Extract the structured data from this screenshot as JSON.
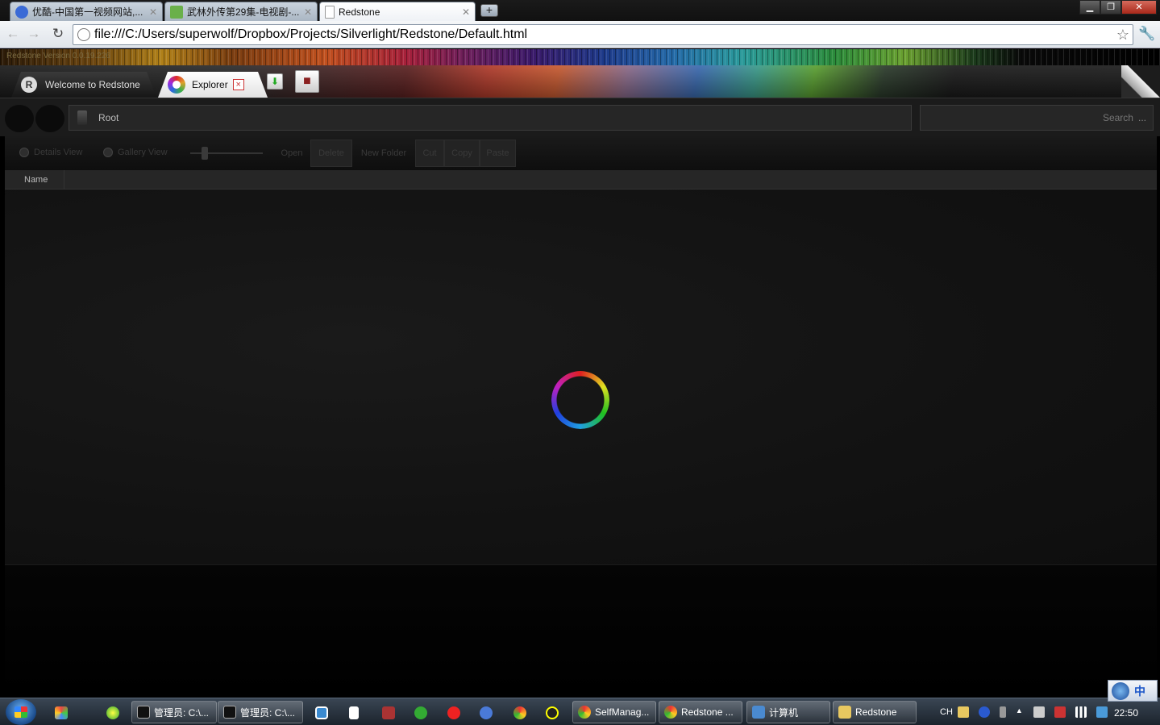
{
  "browser": {
    "tabs": [
      {
        "title": "优酷-中国第一视频网站,...",
        "favicon_color": "#3a6ad6",
        "active": false
      },
      {
        "title": "武林外传第29集-电视剧-...",
        "favicon_color": "#6ab04a",
        "active": false
      },
      {
        "title": "Redstone",
        "favicon_color": "#ffffff",
        "active": true
      }
    ],
    "new_tab_label": "+",
    "url": "file:///C:/Users/superwolf/Dropbox/Projects/Silverlight/Redstone/Default.html"
  },
  "app": {
    "version": "Redstone Version 0.0.19.226",
    "tabs": [
      {
        "label": "Welcome to Redstone",
        "icon_letter": "R"
      },
      {
        "label": "Explorer",
        "close": "×"
      }
    ],
    "breadcrumb": {
      "root": "Root"
    },
    "search": {
      "placeholder": "Search",
      "more": "..."
    },
    "view_options": {
      "details": "Details View",
      "gallery": "Gallery View"
    },
    "commands": {
      "open": "Open",
      "delete": "Delete",
      "new_folder": "New Folder",
      "cut": "Cut",
      "copy": "Copy",
      "paste": "Paste"
    },
    "columns": [
      {
        "label": "Name"
      }
    ]
  },
  "taskbar": {
    "windows": [
      {
        "label": "管理员: C:\\...",
        "icon_color": "#222"
      },
      {
        "label": "管理员: C:\\...",
        "icon_color": "#222"
      },
      {
        "label": "SelfManag...",
        "icon_color": "#e0a020"
      },
      {
        "label": "Redstone ...",
        "icon_color": "#e0a020"
      },
      {
        "label": "计算机",
        "icon_color": "#4a8ad0"
      },
      {
        "label": "Redstone",
        "icon_color": "#e8c860"
      }
    ],
    "tray": {
      "lang": "CH"
    },
    "clock": "22:50",
    "ime": "中"
  },
  "colors": {
    "accent_red": "#cc3333",
    "chrome_blue": "#aab6c3"
  }
}
